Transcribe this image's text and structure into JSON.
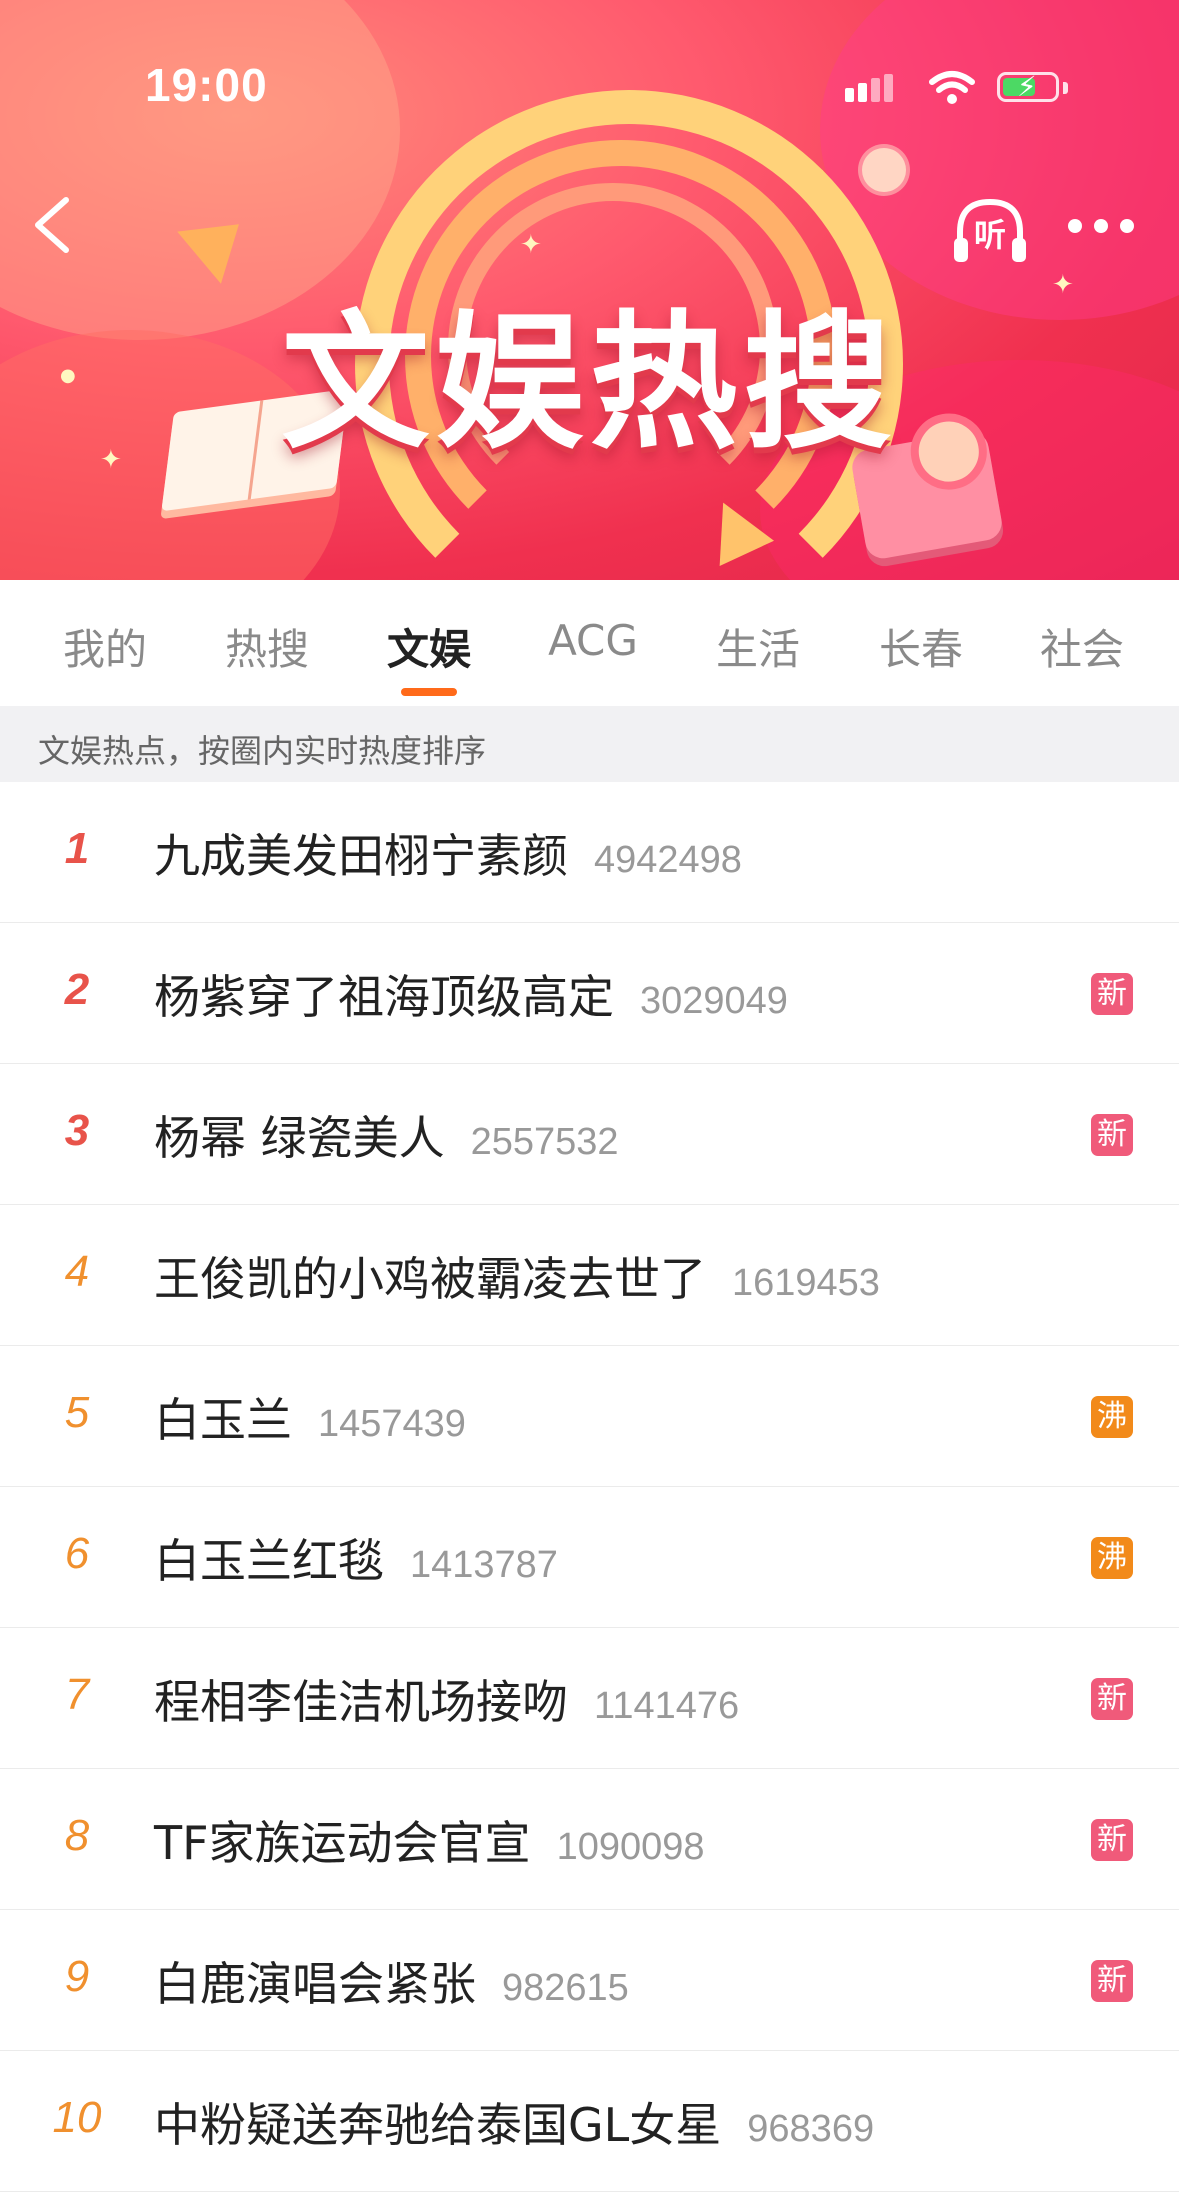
{
  "status_bar": {
    "time": "19:00"
  },
  "header": {
    "banner_title": "文娱热搜",
    "listen_label": "听"
  },
  "tabs": [
    {
      "label": "我的",
      "active": false
    },
    {
      "label": "热搜",
      "active": false
    },
    {
      "label": "文娱",
      "active": true
    },
    {
      "label": "ACG",
      "active": false
    },
    {
      "label": "生活",
      "active": false
    },
    {
      "label": "长春",
      "active": false
    },
    {
      "label": "社会",
      "active": false
    }
  ],
  "hint": "文娱热点，按圈内实时热度排序",
  "colors": {
    "accent": "#ff6a1a",
    "rank_top": "#e8534a",
    "rank_other": "#f0902e",
    "tag_new": "#f05a7a",
    "tag_hot": "#f28a1a"
  },
  "items": [
    {
      "rank": "1",
      "title": "九成美发田栩宁素颜",
      "count": "4942498",
      "tag": ""
    },
    {
      "rank": "2",
      "title": "杨紫穿了祖海顶级高定",
      "count": "3029049",
      "tag": "新"
    },
    {
      "rank": "3",
      "title": "杨幂 绿瓷美人",
      "count": "2557532",
      "tag": "新"
    },
    {
      "rank": "4",
      "title": "王俊凯的小鸡被霸凌去世了",
      "count": "1619453",
      "tag": ""
    },
    {
      "rank": "5",
      "title": "白玉兰",
      "count": "1457439",
      "tag": "沸"
    },
    {
      "rank": "6",
      "title": "白玉兰红毯",
      "count": "1413787",
      "tag": "沸"
    },
    {
      "rank": "7",
      "title": "程相李佳洁机场接吻",
      "count": "1141476",
      "tag": "新"
    },
    {
      "rank": "8",
      "title": "TF家族运动会官宣",
      "count": "1090098",
      "tag": "新"
    },
    {
      "rank": "9",
      "title": "白鹿演唱会紧张",
      "count": "982615",
      "tag": "新"
    },
    {
      "rank": "10",
      "title": "中粉疑送奔驰给泰国GL女星",
      "count": "968369",
      "tag": ""
    }
  ]
}
